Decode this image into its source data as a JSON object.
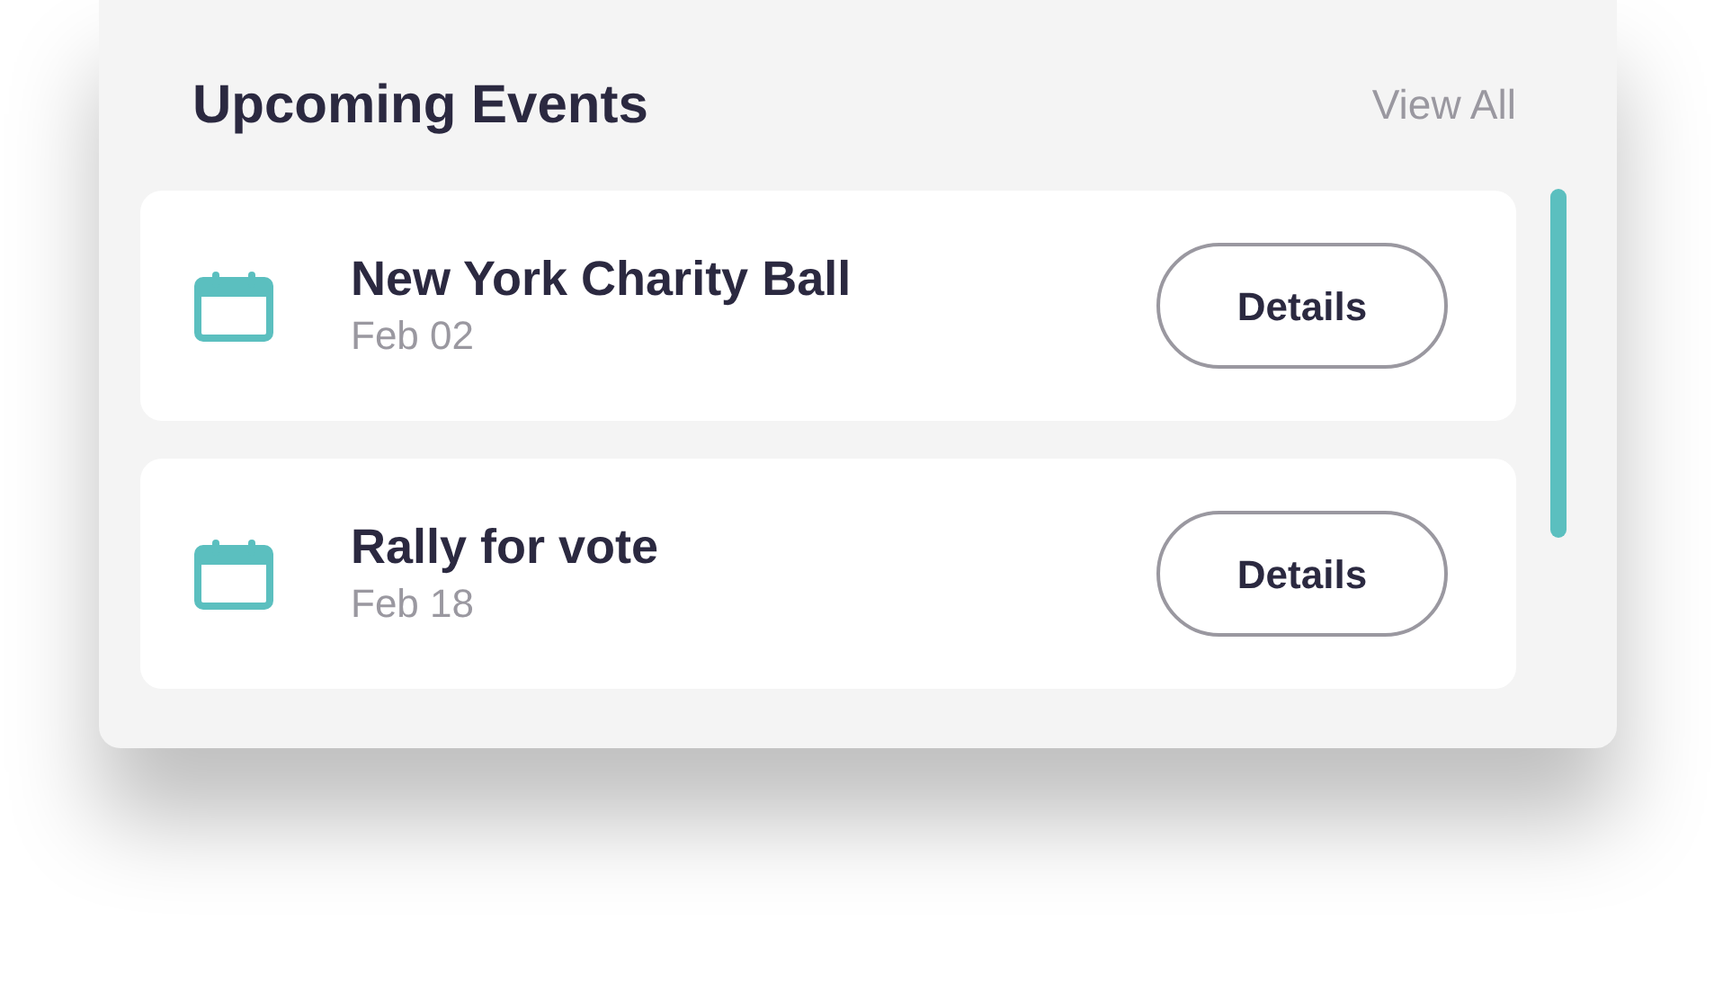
{
  "title": "Upcoming Events",
  "view_all": "View All",
  "events": [
    {
      "name": "New York Charity Ball",
      "date": "Feb 02",
      "button": "Details"
    },
    {
      "name": "Rally for vote",
      "date": "Feb 18",
      "button": "Details"
    }
  ]
}
